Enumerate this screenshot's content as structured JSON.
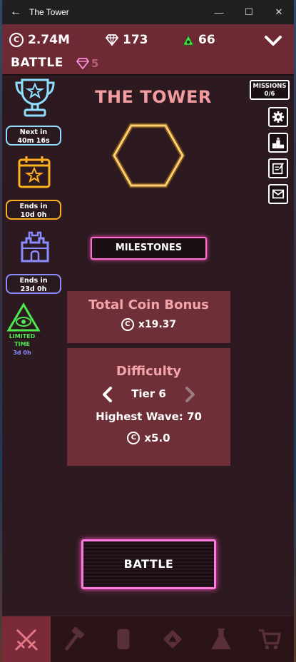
{
  "window": {
    "title": "The Tower"
  },
  "resources": {
    "coins": "2.74M",
    "gems": "173",
    "medals": "66"
  },
  "header": {
    "mode": "BATTLE",
    "gem_count": "5"
  },
  "events": [
    {
      "name": "tournament",
      "line1": "Next in",
      "line2": "40m 16s",
      "color": "#8fe0ff"
    },
    {
      "name": "calendar",
      "line1": "Ends in",
      "line2": "10d 0h",
      "color": "#ffb020"
    },
    {
      "name": "castle",
      "line1": "Ends in",
      "line2": "23d 0h",
      "color": "#8a8cff"
    }
  ],
  "limited": {
    "line1": "LIMITED",
    "line2": "TIME",
    "timer": "3d 0h"
  },
  "missions": {
    "label": "MISSIONS",
    "count": "0/6"
  },
  "main": {
    "title": "THE TOWER",
    "milestones_label": "MILESTONES",
    "coin_bonus_title": "Total Coin Bonus",
    "coin_bonus_value": "x19.37",
    "difficulty_title": "Difficulty",
    "tier": "Tier 6",
    "highest_wave": "Highest Wave: 70",
    "difficulty_multiplier": "x5.0",
    "battle_label": "BATTLE"
  },
  "coin_symbol": "C",
  "colors": {
    "accent_pink": "#ff6fd0",
    "hex_glow": "#ffb020",
    "title_pink": "#f29ca1",
    "panel": "#6e2f39",
    "topbar": "#6e2a34",
    "limited_green": "#4ee84e"
  },
  "nav": [
    {
      "icon": "swords-icon",
      "active": true
    },
    {
      "icon": "hammer-icon",
      "active": false
    },
    {
      "icon": "card-icon",
      "active": false
    },
    {
      "icon": "module-icon",
      "active": false
    },
    {
      "icon": "flask-icon",
      "active": false
    },
    {
      "icon": "cart-icon",
      "active": false
    }
  ]
}
